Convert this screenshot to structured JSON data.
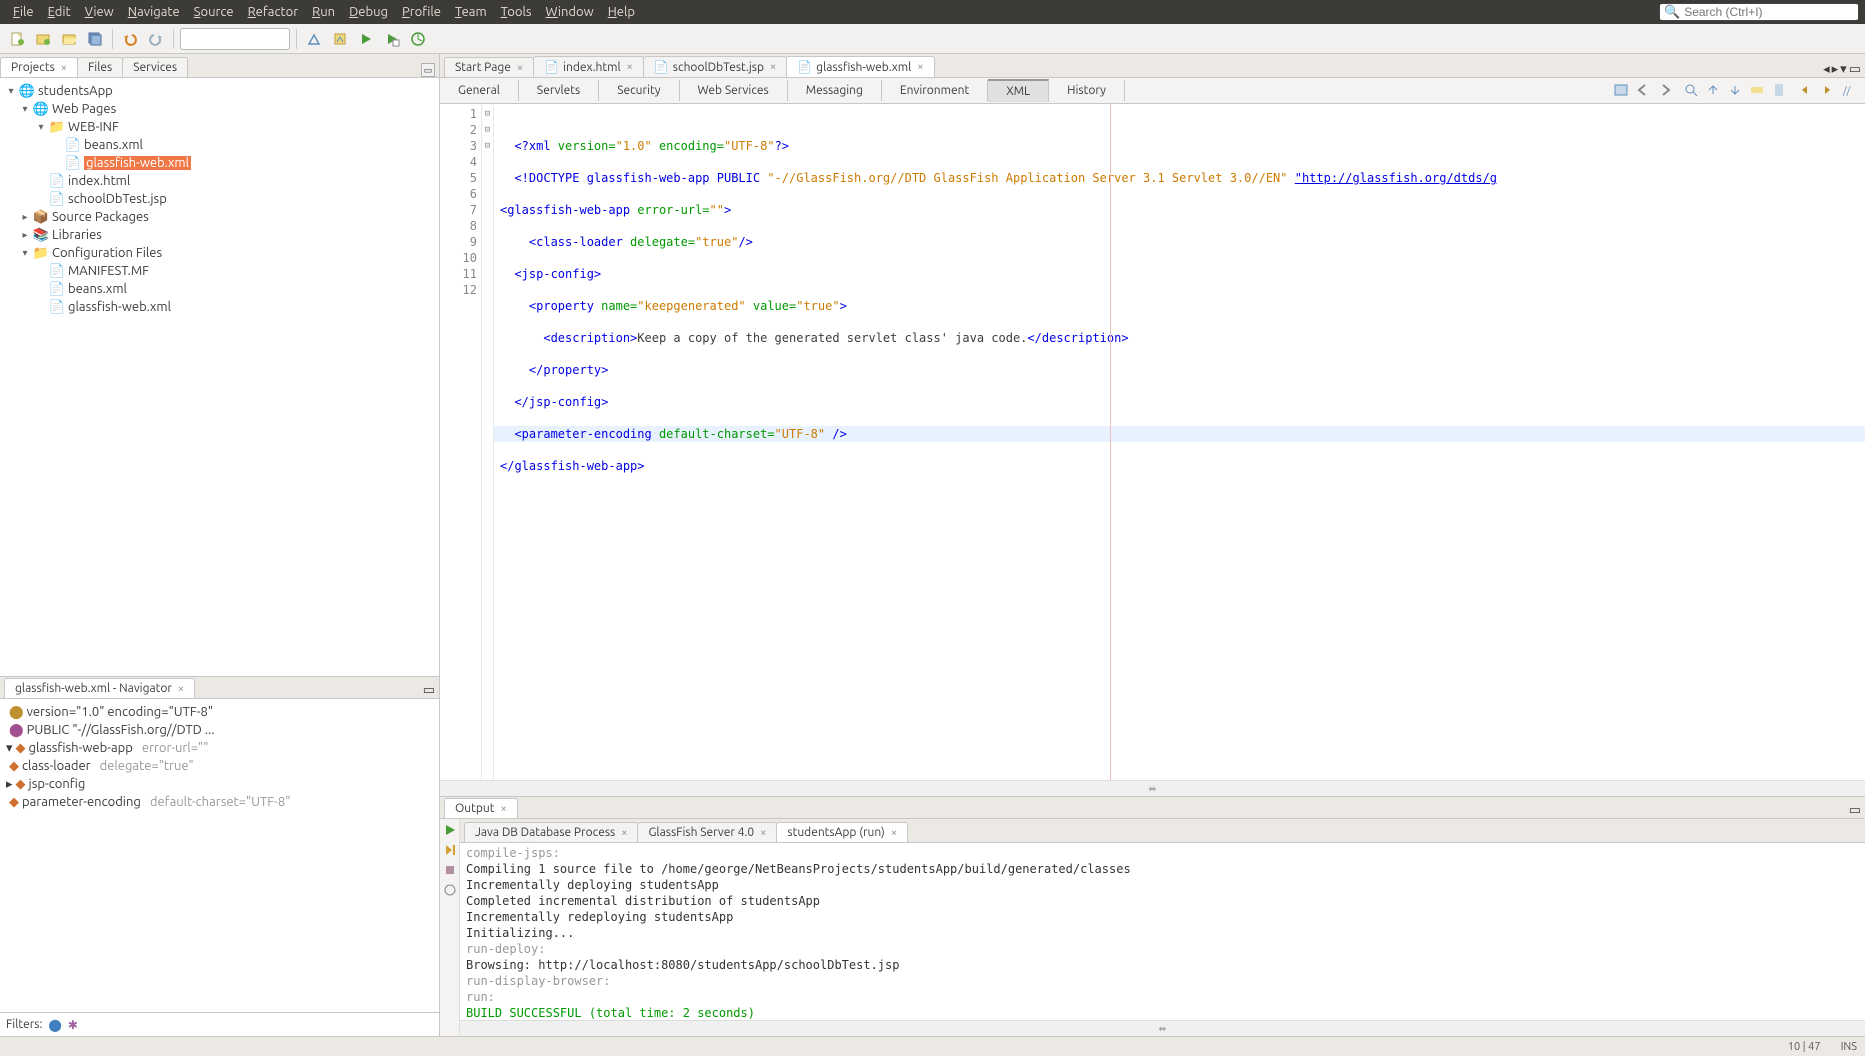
{
  "menubar": {
    "items": [
      "File",
      "Edit",
      "View",
      "Navigate",
      "Source",
      "Refactor",
      "Run",
      "Debug",
      "Profile",
      "Team",
      "Tools",
      "Window",
      "Help"
    ],
    "search_placeholder": "Search (Ctrl+I)"
  },
  "left": {
    "panel_tabs": [
      "Projects",
      "Files",
      "Services"
    ],
    "tree": {
      "root": "studentsApp",
      "webpages": "Web Pages",
      "webinf": "WEB-INF",
      "beans_xml": "beans.xml",
      "glassfish_xml": "glassfish-web.xml",
      "index_html": "index.html",
      "school_jsp": "schoolDbTest.jsp",
      "source_pkg": "Source Packages",
      "libraries": "Libraries",
      "config_files": "Configuration Files",
      "manifest": "MANIFEST.MF",
      "beans_xml2": "beans.xml",
      "glassfish_xml2": "glassfish-web.xml"
    }
  },
  "navigator": {
    "title": "glassfish-web.xml - Navigator",
    "items": {
      "xml_decl": "version=\"1.0\" encoding=\"UTF-8\"",
      "doctype": "PUBLIC \"-//GlassFish.org//DTD ...",
      "root": "glassfish-web-app",
      "root_attr": "error-url=\"\"",
      "classloader": "class-loader",
      "classloader_attr": "delegate=\"true\"",
      "jspconfig": "jsp-config",
      "paramenc": "parameter-encoding",
      "paramenc_attr": "default-charset=\"UTF-8\""
    },
    "filters_label": "Filters:"
  },
  "editor": {
    "tabs": [
      {
        "label": "Start Page",
        "icon": "start"
      },
      {
        "label": "index.html",
        "icon": "html"
      },
      {
        "label": "schoolDbTest.jsp",
        "icon": "jsp"
      },
      {
        "label": "glassfish-web.xml",
        "icon": "xml",
        "active": true
      }
    ],
    "views": [
      "General",
      "Servlets",
      "Security",
      "Web Services",
      "Messaging",
      "Environment",
      "XML",
      "History"
    ],
    "active_view": "XML",
    "code": {
      "l1_a": "<?xml",
      "l1_b": " version=",
      "l1_c": "\"1.0\"",
      "l1_d": " encoding=",
      "l1_e": "\"UTF-8\"",
      "l1_f": "?>",
      "l2_a": "<!DOCTYPE glassfish-web-app PUBLIC ",
      "l2_b": "\"-//GlassFish.org//DTD GlassFish Application Server 3.1 Servlet 3.0//EN\"",
      "l2_c": " ",
      "l2_d": "\"http://glassfish.org/dtds/g",
      "l3_a": "<glassfish-web-app",
      "l3_b": " error-url=",
      "l3_c": "\"\"",
      "l3_d": ">",
      "l4_a": "    <class-loader",
      "l4_b": " delegate=",
      "l4_c": "\"true\"",
      "l4_d": "/>",
      "l5_a": "  <jsp-config>",
      "l6_a": "    <property",
      "l6_b": " name=",
      "l6_c": "\"keepgenerated\"",
      "l6_d": " value=",
      "l6_e": "\"true\"",
      "l6_f": ">",
      "l7_a": "      <description>",
      "l7_b": "Keep a copy of the generated servlet class' java code.",
      "l7_c": "</description>",
      "l8_a": "    </property>",
      "l9_a": "  </jsp-config>",
      "l10_a": "  <parameter-encoding",
      "l10_b": " default-charset=",
      "l10_c": "\"UTF-8\"",
      "l10_d": " />",
      "l11_a": "</glassfish-web-app>"
    },
    "line_numbers": [
      "1",
      "2",
      "3",
      "4",
      "5",
      "6",
      "7",
      "8",
      "9",
      "10",
      "11",
      "12"
    ],
    "fold": [
      "",
      "",
      "⊟",
      "",
      "⊟",
      "⊟",
      "",
      "",
      "",
      "",
      "",
      ""
    ]
  },
  "output": {
    "header": "Output",
    "tabs": [
      "Java DB Database Process",
      "GlassFish Server 4.0",
      "studentsApp (run)"
    ],
    "lines": [
      {
        "cls": "grey",
        "text": "compile-jsps:"
      },
      {
        "cls": "black",
        "text": "Compiling 1 source file to /home/george/NetBeansProjects/studentsApp/build/generated/classes"
      },
      {
        "cls": "black",
        "text": "Incrementally deploying studentsApp"
      },
      {
        "cls": "black",
        "text": "Completed incremental distribution of studentsApp"
      },
      {
        "cls": "black",
        "text": "Incrementally redeploying studentsApp"
      },
      {
        "cls": "black",
        "text": "Initializing..."
      },
      {
        "cls": "grey",
        "text": "run-deploy:"
      },
      {
        "cls": "black",
        "text": "Browsing: http://localhost:8080/studentsApp/schoolDbTest.jsp"
      },
      {
        "cls": "grey",
        "text": "run-display-browser:"
      },
      {
        "cls": "grey",
        "text": "run:"
      },
      {
        "cls": "green",
        "text": "BUILD SUCCESSFUL (total time: 2 seconds)"
      }
    ]
  },
  "status": {
    "pos": "10 | 47",
    "mode": "INS"
  }
}
